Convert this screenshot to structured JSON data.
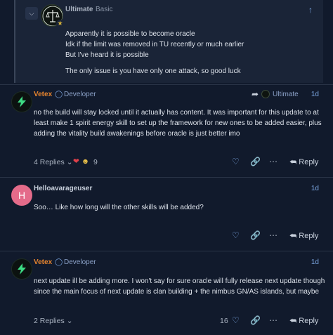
{
  "quote": {
    "username": "Ultimate",
    "title": "Basic",
    "lines": [
      "Apparently it is possible to become oracle",
      "Idk if the limit was removed in TU recently or much earlier",
      "But I've heard it is possible",
      "The only issue is you have only one attack, so good luck"
    ],
    "collapse_icon": "chevron-down-icon",
    "up_icon": "arrow-up-icon"
  },
  "posts": [
    {
      "username": "Vetex",
      "role": "Developer",
      "reply_to": "Ultimate",
      "age": "1d",
      "lines": [
        "no the build will stay locked until it actually has content. It was important for this update to at",
        "least make 1 spirit energy skill to set up the framework for new ones to be added easier, plus",
        "adding the vitality build awakenings before oracle is just better imo"
      ],
      "replies": "4 Replies",
      "reaction_count": "9",
      "reply_label": "Reply"
    },
    {
      "username": "Helloavarageuser",
      "avatar_letter": "H",
      "age": "1d",
      "lines": [
        "Soo… Like how long will the other skills will be added?"
      ],
      "reply_label": "Reply"
    },
    {
      "username": "Vetex",
      "role": "Developer",
      "age": "1d",
      "lines": [
        "next update ill be adding more. I won't say for sure oracle will fully release next update though",
        "since the main focus of next update is clan building + the nimbus GN/AS islands, but maybe"
      ],
      "replies": "2 Replies",
      "like_count": "16",
      "reply_label": "Reply"
    }
  ],
  "colors": {
    "background": "#111a2c",
    "vetex_name": "#e8852e",
    "link_blue": "#7aa5e0",
    "bolt_green": "#3ddc84"
  }
}
